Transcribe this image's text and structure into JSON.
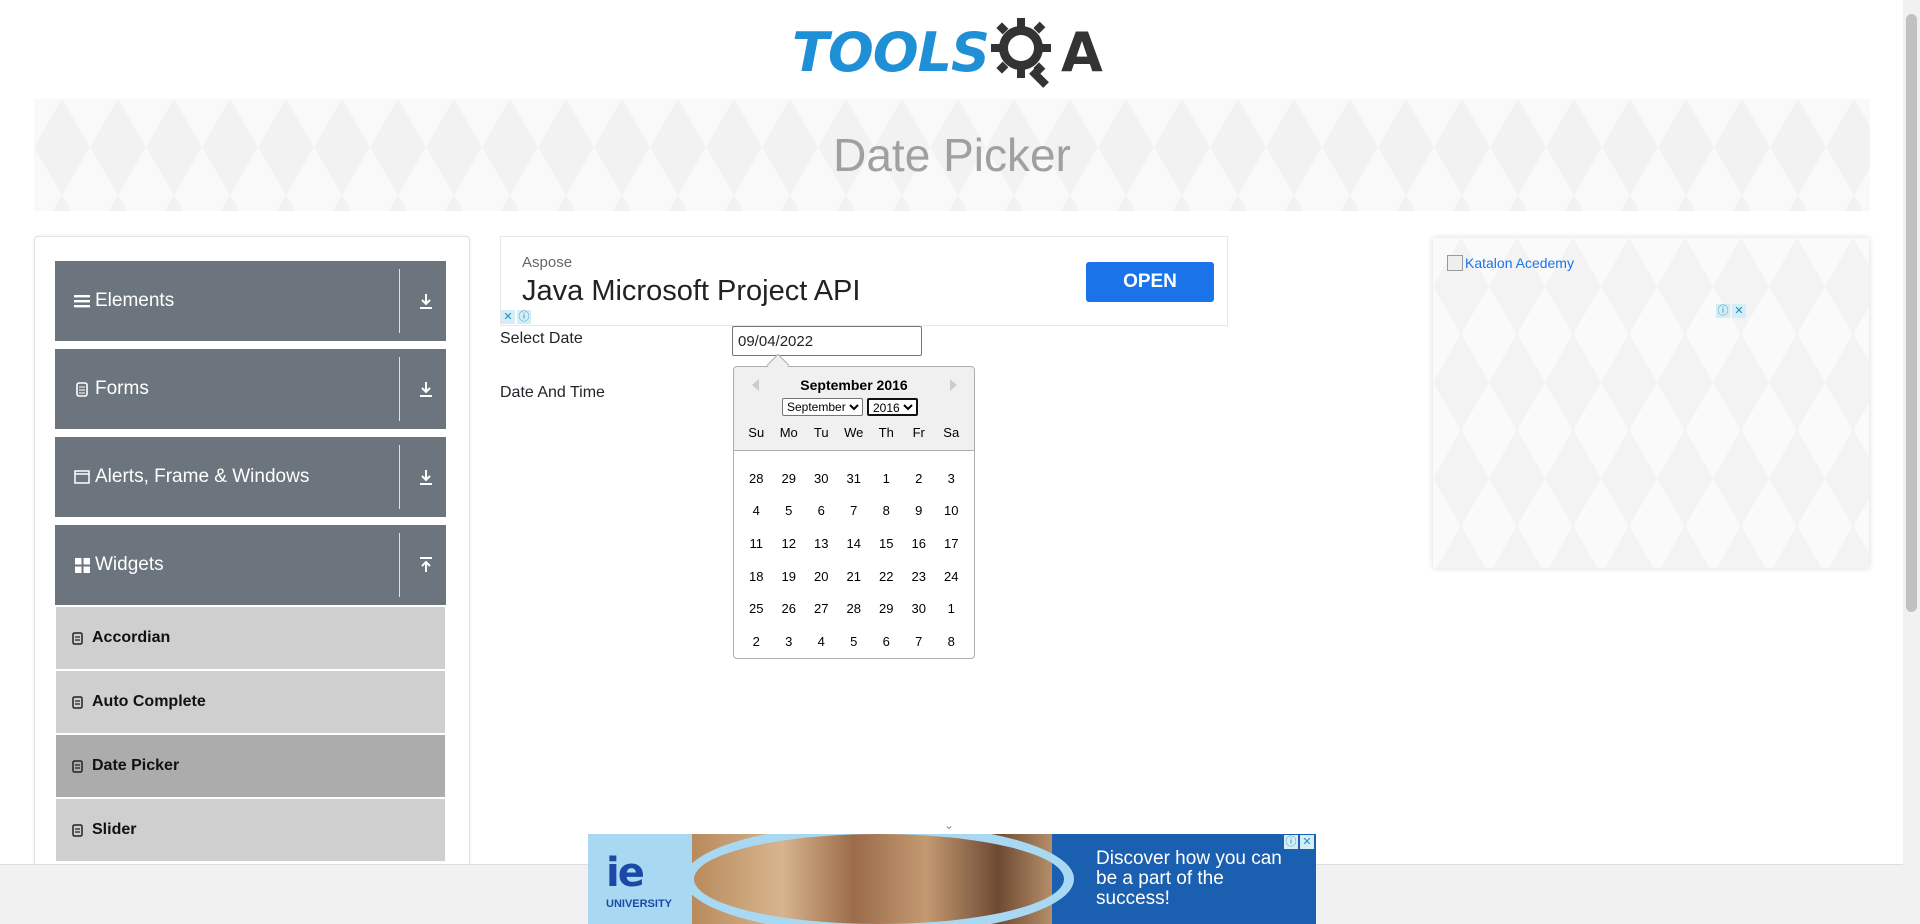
{
  "header": {
    "logo_text": "TOOLS",
    "logo_suffix": "A",
    "logo_alt": "ToolsQA"
  },
  "banner": {
    "title": "Date Picker"
  },
  "sidebar": {
    "groups": [
      {
        "label": "Elements",
        "icon": "hamburger-icon",
        "state": "collapsed"
      },
      {
        "label": "Forms",
        "icon": "document-icon",
        "state": "collapsed"
      },
      {
        "label": "Alerts, Frame & Windows",
        "icon": "window-icon",
        "state": "collapsed"
      },
      {
        "label": "Widgets",
        "icon": "grid-icon",
        "state": "expanded"
      }
    ],
    "widget_items": [
      {
        "label": "Accordian",
        "active": false
      },
      {
        "label": "Auto Complete",
        "active": false
      },
      {
        "label": "Date Picker",
        "active": true
      },
      {
        "label": "Slider",
        "active": false
      }
    ]
  },
  "ad_top": {
    "brand": "Aspose",
    "headline": "Java Microsoft Project API",
    "button": "OPEN"
  },
  "form": {
    "select_date_label": "Select Date",
    "select_date_value": "09/04/2022",
    "date_time_label": "Date And Time"
  },
  "calendar": {
    "title": "September 2016",
    "month_selected": "September",
    "year_selected": "2016",
    "weekdays": [
      "Su",
      "Mo",
      "Tu",
      "We",
      "Th",
      "Fr",
      "Sa"
    ],
    "weeks": [
      [
        "28",
        "29",
        "30",
        "31",
        "1",
        "2",
        "3"
      ],
      [
        "4",
        "5",
        "6",
        "7",
        "8",
        "9",
        "10"
      ],
      [
        "11",
        "12",
        "13",
        "14",
        "15",
        "16",
        "17"
      ],
      [
        "18",
        "19",
        "20",
        "21",
        "22",
        "23",
        "24"
      ],
      [
        "25",
        "26",
        "27",
        "28",
        "29",
        "30",
        "1"
      ],
      [
        "2",
        "3",
        "4",
        "5",
        "6",
        "7",
        "8"
      ]
    ]
  },
  "ad_right": {
    "alt_text": "Katalon Acedemy"
  },
  "ad_bottom": {
    "logo": "ie",
    "logo_sub": "UNIVERSITY",
    "cta": "Discover how you can be a part of the success!"
  },
  "colors": {
    "accent": "#1f8fd6",
    "nav_group": "#6c757d",
    "nav_item": "#cfcfcf",
    "nav_item_active": "#acacac"
  }
}
